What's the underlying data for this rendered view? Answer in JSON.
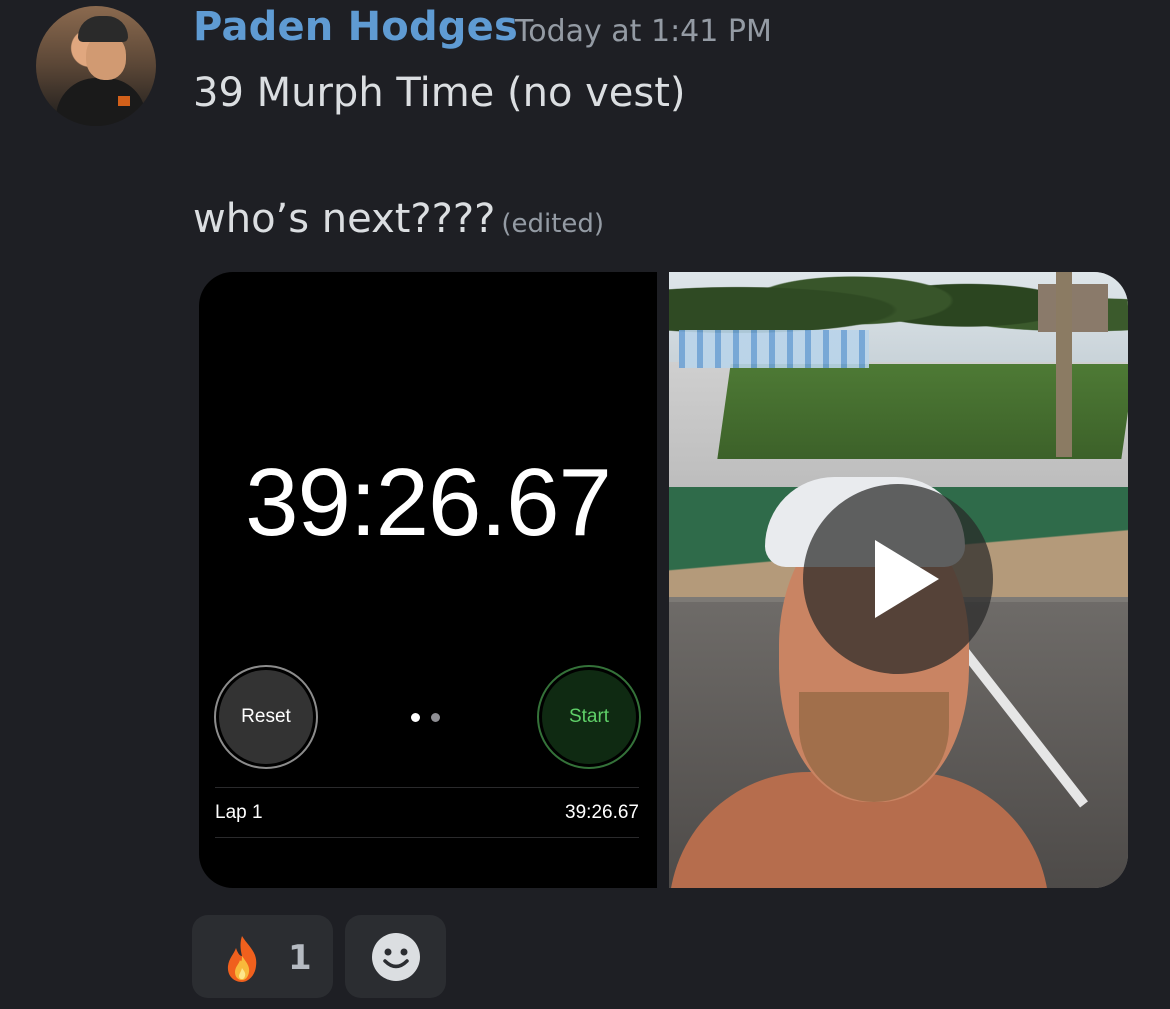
{
  "message": {
    "author": "Paden Hodges",
    "timestamp": "Today at 1:41 PM",
    "line1": "39 Murph Time (no vest)",
    "line2": "who’s next????",
    "edited_label": "(edited)"
  },
  "stopwatch": {
    "time": "39:26.67",
    "reset_label": "Reset",
    "start_label": "Start",
    "lap_label": "Lap 1",
    "lap_time": "39:26.67"
  },
  "video": {
    "play_icon": "play-icon"
  },
  "reactions": {
    "fire": {
      "emoji": "fire-icon",
      "count": "1"
    },
    "add": {
      "icon": "add-reaction-smiley-icon"
    }
  },
  "colors": {
    "background": "#1e1f24",
    "username": "#5f9bd3",
    "timestamp": "#949ba4",
    "text": "#dbdee1",
    "reaction_bg": "#2b2d31"
  }
}
